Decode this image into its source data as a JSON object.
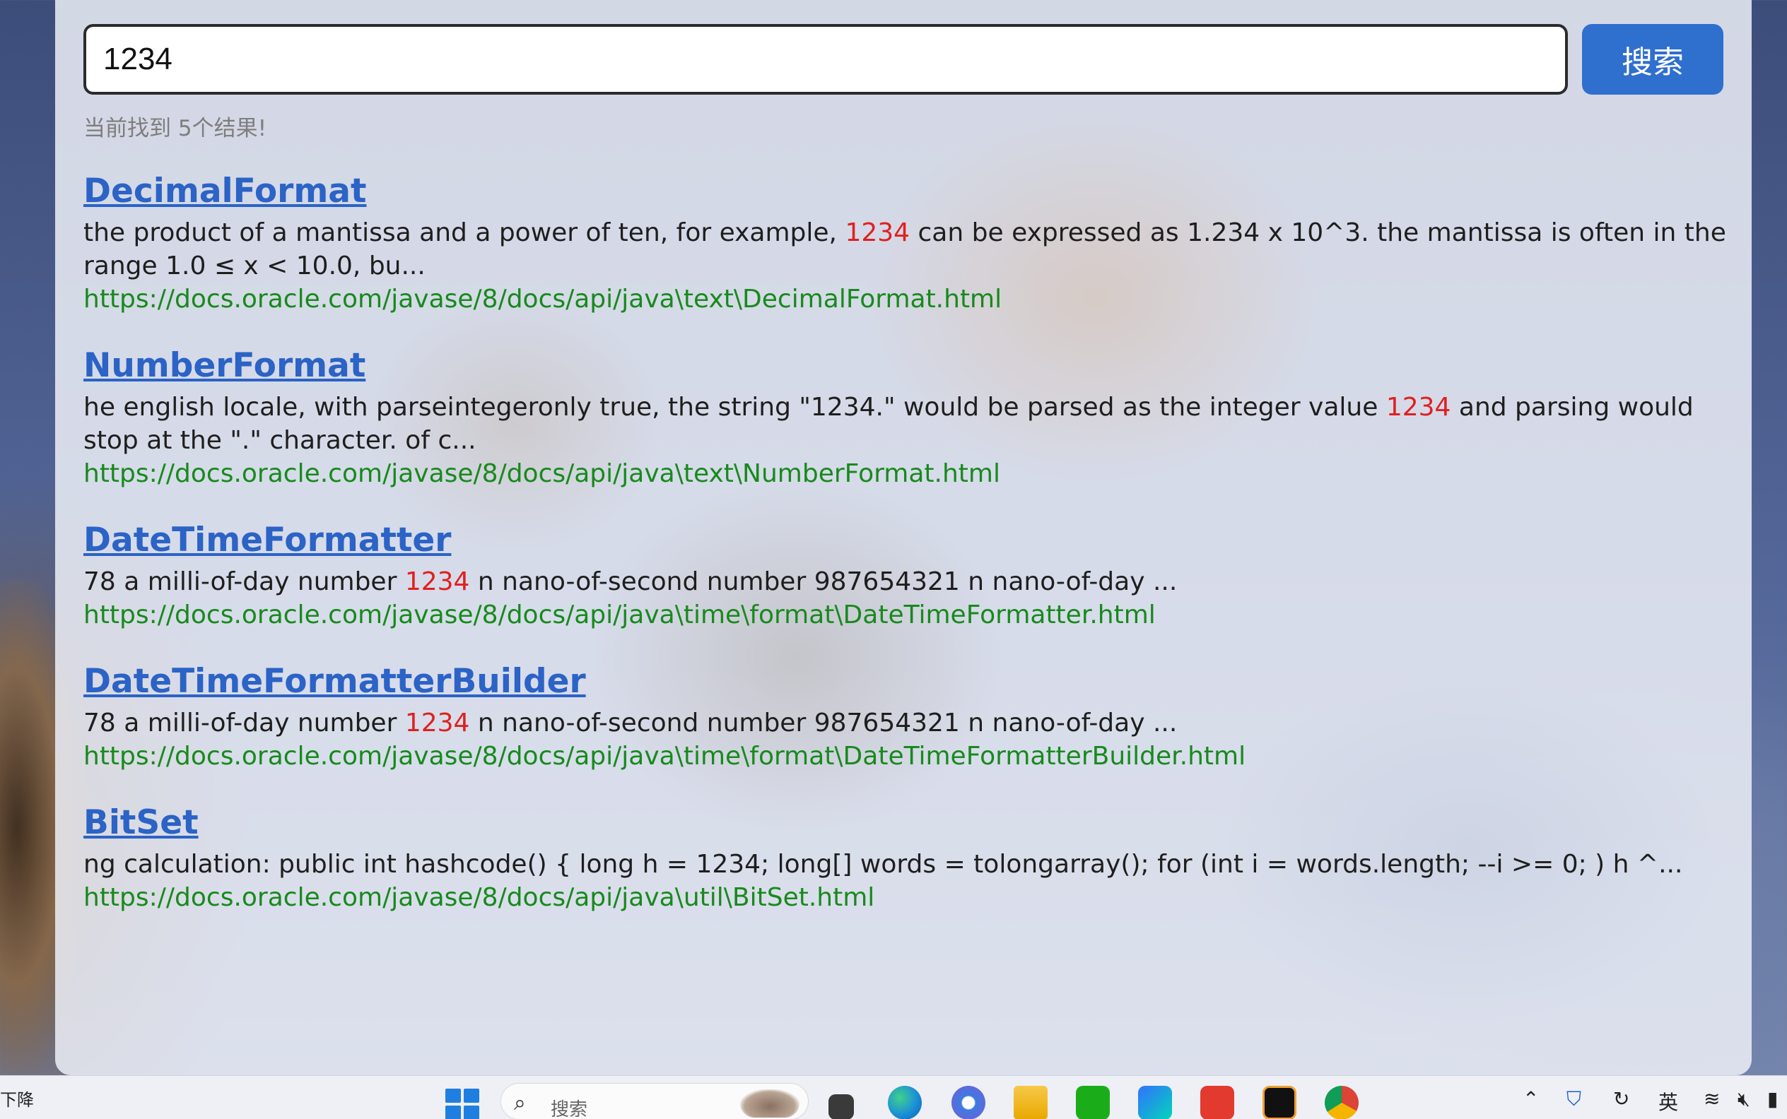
{
  "search": {
    "query": "1234",
    "button_label": "搜索"
  },
  "result_count": "当前找到 5个结果!",
  "results": [
    {
      "title": "DecimalFormat",
      "desc_before": "the product of a mantissa and a power of ten, for example, ",
      "highlight": "1234",
      "desc_after": " can be expressed as 1.234 x 10^3. the mantissa is often in the range 1.0 ≤ x < 10.0, bu...",
      "url": "https://docs.oracle.com/javase/8/docs/api/java\\text\\DecimalFormat.html"
    },
    {
      "title": "NumberFormat",
      "desc_before": "he english locale, with parseintegeronly true, the string \"1234.\" would be parsed as the integer value ",
      "highlight": "1234",
      "desc_after": " and parsing would stop at the \".\" character. of c...",
      "url": "https://docs.oracle.com/javase/8/docs/api/java\\text\\NumberFormat.html"
    },
    {
      "title": "DateTimeFormatter",
      "desc_before": "78 a milli-of-day number ",
      "highlight": "1234",
      "desc_after": " n nano-of-second number 987654321 n nano-of-day ...",
      "url": "https://docs.oracle.com/javase/8/docs/api/java\\time\\format\\DateTimeFormatter.html"
    },
    {
      "title": "DateTimeFormatterBuilder",
      "desc_before": "78 a milli-of-day number ",
      "highlight": "1234",
      "desc_after": " n nano-of-second number 987654321 n nano-of-day ...",
      "url": "https://docs.oracle.com/javase/8/docs/api/java\\time\\format\\DateTimeFormatterBuilder.html"
    },
    {
      "title": "BitSet",
      "desc_before": "ng calculation: public int hashcode() { long h = 1234; long[] words = tolongarray(); for (int i = words.length; --i >= 0; ) h ^...",
      "highlight": "",
      "desc_after": "",
      "url": "https://docs.oracle.com/javase/8/docs/api/java\\util\\BitSet.html"
    }
  ],
  "taskbar": {
    "weather_text": "下降",
    "search_label": "搜索",
    "input_lang": "英",
    "apps": [
      "edge-icon",
      "copilot-icon",
      "file-explorer-icon",
      "wechat-icon",
      "feishu-icon",
      "wps-icon",
      "intellij-icon",
      "chrome-icon"
    ],
    "colors": {
      "accent": "#2f6fce",
      "title_link": "#2b63c6",
      "highlight": "#e02020",
      "url_green": "#178a1c"
    }
  }
}
